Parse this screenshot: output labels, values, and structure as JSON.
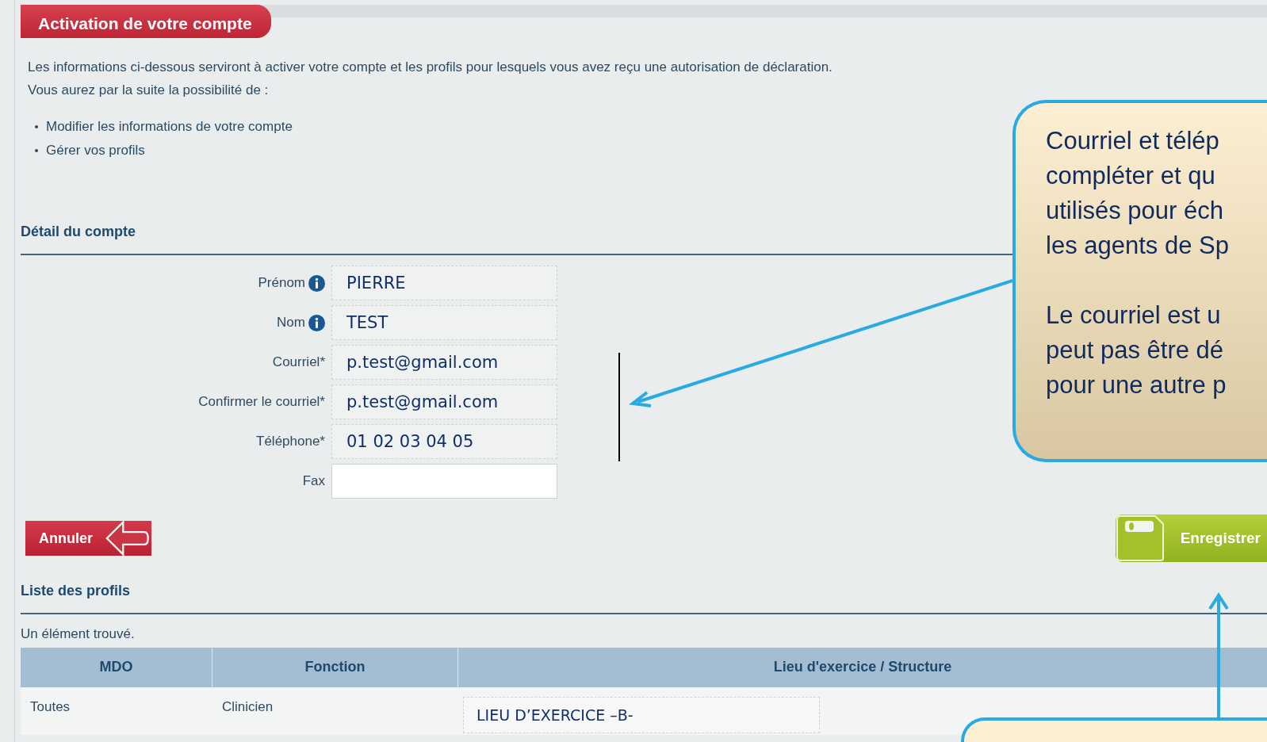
{
  "header": {
    "title": "Activation de votre compte"
  },
  "intro": {
    "lines": [
      "Les informations ci-dessous serviront à activer votre compte et les profils pour lesquels vous avez reçu une autorisation de déclaration.",
      "Vous aurez par la suite la possibilité de :"
    ],
    "bullets": [
      "Modifier les informations de votre compte",
      "Gérer vos profils"
    ]
  },
  "account": {
    "title": "Détail du compte",
    "fields": [
      {
        "label": "Prénom",
        "info": true,
        "value": "PIERRE",
        "readonly": true
      },
      {
        "label": "Nom",
        "info": true,
        "value": "TEST",
        "readonly": true
      },
      {
        "label": "Courriel*",
        "info": false,
        "value": "p.test@gmail.com",
        "readonly": true
      },
      {
        "label": "Confirmer le courriel*",
        "info": false,
        "value": "p.test@gmail.com",
        "readonly": true
      },
      {
        "label": "Téléphone*",
        "info": false,
        "value": "01 02 03 04 05",
        "readonly": true
      },
      {
        "label": "Fax",
        "info": false,
        "readonly": false
      }
    ]
  },
  "actions": {
    "cancel": "Annuler",
    "save": "Enregistrer"
  },
  "profiles": {
    "title": "Liste des profils",
    "count_text": "Un élément trouvé.",
    "columns": [
      "MDO",
      "Fonction",
      "Lieu d'exercice / Structure"
    ],
    "rows": [
      [
        "Toutes",
        "Clinicien",
        "LIEU D’EXERCICE –B-"
      ]
    ]
  },
  "callout": {
    "paragraphs": [
      [
        "Courriel et télép",
        "compléter et qu",
        "utilisés pour éch",
        "les agents de Sp"
      ],
      [
        "Le courriel est u",
        "peut pas être dé",
        "pour une autre p"
      ]
    ]
  }
}
